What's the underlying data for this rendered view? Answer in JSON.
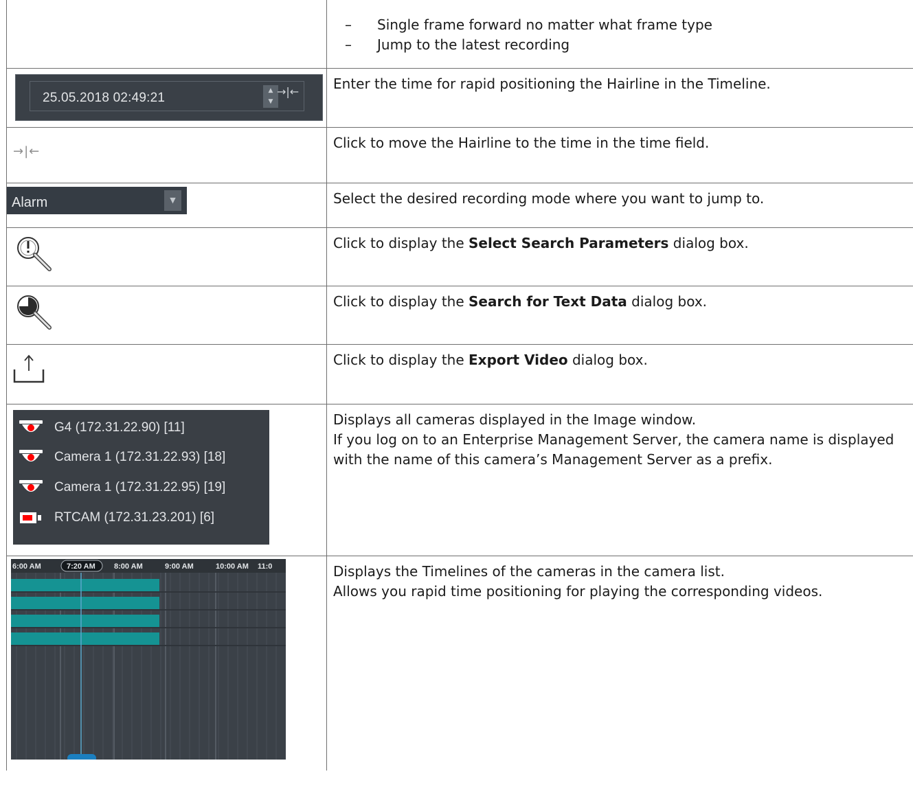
{
  "rows": [
    {
      "bullets": [
        {
          "dash": "–",
          "text": "Single frame forward no matter what frame type"
        },
        {
          "dash": "–",
          "text": "Jump to the latest recording"
        }
      ]
    },
    {
      "widget": {
        "time_value": "25.05.2018 02:49:21",
        "jump_icon": "jump-to-time-icon",
        "jump_glyph": "→|←"
      },
      "description": "Enter the time for rapid positioning the Hairline in the Timeline."
    },
    {
      "widget": {
        "icon": "jump-to-time-icon",
        "glyph": "→|←"
      },
      "description": "Click to move the Hairline to the time in the time field."
    },
    {
      "widget": {
        "selected": "Alarm",
        "arrow_icon": "chevron-down-icon"
      },
      "description": "Select the desired recording mode where you want to jump to."
    },
    {
      "widget": {
        "icon": "alarm-search-icon"
      },
      "description_pre": "Click to display the ",
      "description_bold": "Select Search Parameters",
      "description_post": " dialog box."
    },
    {
      "widget": {
        "icon": "text-data-search-icon"
      },
      "description_pre": "Click to display the ",
      "description_bold": "Search for Text Data",
      "description_post": " dialog box."
    },
    {
      "widget": {
        "icon": "export-icon"
      },
      "description_pre": "Click to display the ",
      "description_bold": "Export Video",
      "description_post": " dialog box."
    },
    {
      "widget": {
        "cameras": [
          {
            "icon": "dome-camera-icon",
            "name": "G4 (172.31.22.90) [11]"
          },
          {
            "icon": "dome-camera-icon",
            "name": "Camera 1 (172.31.22.93) [18]"
          },
          {
            "icon": "dome-camera-icon",
            "name": "Camera 1 (172.31.22.95) [19]"
          },
          {
            "icon": "box-camera-icon",
            "name": "RTCAM (172.31.23.201) [6]"
          }
        ],
        "recording_color": "#ff0000"
      },
      "description_line1": "Displays all cameras displayed in the Image window.",
      "description_line2": "If you log on to an Enterprise Management Server, the camera name is displayed with the name of this camera’s Management Server as a prefix."
    },
    {
      "widget": {
        "time_labels": [
          "6:00 AM",
          "7:20 AM",
          "8:00 AM",
          "9:00 AM",
          "10:00 AM",
          "11:0"
        ],
        "hairline_label": "7:20 AM",
        "recording_color": "#159393",
        "hairline_color": "#5aa7cc",
        "handle_color": "#1b7fc0"
      },
      "description_line1": "Displays the Timelines of the cameras in the camera list.",
      "description_line2": "Allows you rapid time positioning for playing the corresponding videos."
    }
  ]
}
